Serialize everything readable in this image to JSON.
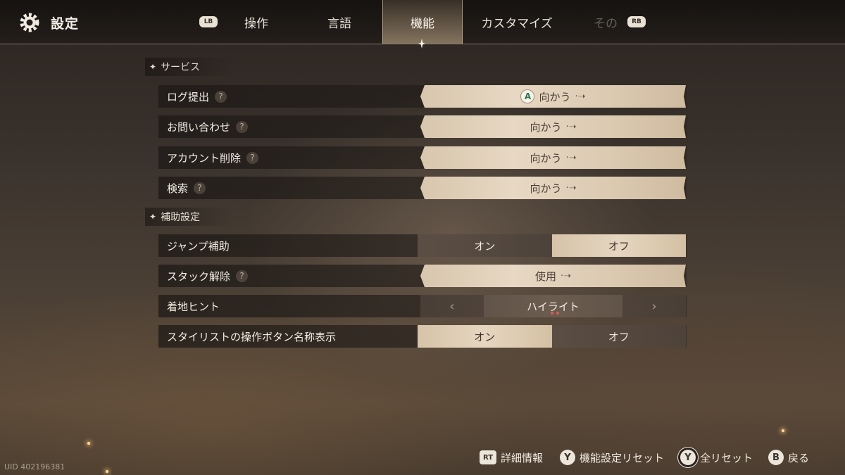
{
  "header": {
    "title": "設定",
    "lb": "LB",
    "rb": "RB",
    "tabs": [
      {
        "label": "操作"
      },
      {
        "label": "言語"
      },
      {
        "label": "機能"
      },
      {
        "label": "カスタマイズ"
      },
      {
        "label": "その"
      }
    ],
    "active_tab": "機能"
  },
  "sections": {
    "service": {
      "title": "サービス",
      "rows": [
        {
          "label": "ログ提出",
          "help": "?",
          "button_key": "A",
          "action": "向かう"
        },
        {
          "label": "お問い合わせ",
          "help": "?",
          "action": "向かう"
        },
        {
          "label": "アカウント削除",
          "help": "?",
          "action": "向かう"
        },
        {
          "label": "検索",
          "help": "?",
          "action": "向かう"
        }
      ]
    },
    "assist": {
      "title": "補助設定",
      "jump": {
        "label": "ジャンプ補助",
        "on": "オン",
        "off": "オフ",
        "selected": "オフ"
      },
      "unstuck": {
        "label": "スタック解除",
        "help": "?",
        "action": "使用"
      },
      "landing": {
        "label": "着地ヒント",
        "value": "ハイライト",
        "prev": "‹",
        "next": "›"
      },
      "stylist": {
        "label": "スタイリストの操作ボタン名称表示",
        "on": "オン",
        "off": "オフ",
        "selected": "オン"
      }
    }
  },
  "footer": {
    "details": {
      "key": "RT",
      "label": "詳細情報"
    },
    "reset_feature": {
      "key": "Y",
      "label": "機能設定リセット"
    },
    "reset_all": {
      "key": "Y",
      "label": "全リセット"
    },
    "back": {
      "key": "B",
      "label": "戻る"
    }
  },
  "uid": "UID 402196381",
  "colors": {
    "accent_panel": "#e7d8c3",
    "dark_panel": "#2a2420",
    "indicator_dot": "#d85c5c"
  }
}
